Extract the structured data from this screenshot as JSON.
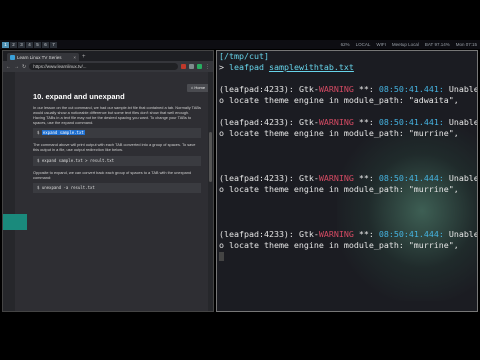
{
  "topbar": {
    "workspaces": [
      "1",
      "2",
      "3",
      "4",
      "5",
      "6",
      "7"
    ],
    "active_workspace": 1,
    "status_items": [
      "62%",
      "LOCAL",
      "WIFI",
      "Meetup Local",
      "BAT 97.14%",
      "Mon 07:15"
    ]
  },
  "browser": {
    "tab_title": "Learn Linux TV Series",
    "tab_close": "×",
    "new_tab": "+",
    "url": "https://www.learnlinux.tv/...",
    "home_button": "Home",
    "heading": "10. expand and unexpand",
    "para1": "In our lesson on the cut command, we had our sample.txt file that contained a tab. Normally TABs would usually show a noticeable difference but some text files don't show that well enough. Having TABs in a text file may not be the desired spacing you want. To change your TABs to spaces, use the expand command.",
    "code1_prefix": "$",
    "code1": "expand sample.txt",
    "para2": "The command above will print output with each TAB converted into a group of spaces. To save this output in a file, use output redirection like below.",
    "code2": "$ expand sample.txt > result.txt",
    "para3": "Opposite to expand, we can convert back each group of spaces to a TAB with the unexpand command:",
    "code3": "$ unexpand -a result.txt"
  },
  "terminal": {
    "cwd": "[/tmp/cut]",
    "prompt": ">",
    "command": "leafpad",
    "argument": "samplewithtab.txt",
    "warnings": [
      {
        "pid": "(leafpad:4233):",
        "lib": "Gtk-",
        "level": "WARNING",
        "stars": "**:",
        "time": "08:50:41.441:",
        "msg": "Unable t",
        "cont": "o locate theme engine in module_path: \"adwaita\","
      },
      {
        "pid": "(leafpad:4233):",
        "lib": "Gtk-",
        "level": "WARNING",
        "stars": "**:",
        "time": "08:50:41.441:",
        "msg": "Unable t",
        "cont": "o locate theme engine in module_path: \"murrine\","
      },
      {
        "pid": "(leafpad:4233):",
        "lib": "Gtk-",
        "level": "WARNING",
        "stars": "**:",
        "time": "08:50:41.444:",
        "msg": "Unable t",
        "cont": "o locate theme engine in module_path: \"murrine\","
      },
      {
        "pid": "(leafpad:4233):",
        "lib": "Gtk-",
        "level": "WARNING",
        "stars": "**:",
        "time": "08:50:41.444:",
        "msg": "Unable t",
        "cont": "o locate theme engine in module_path: \"murrine\","
      }
    ]
  }
}
